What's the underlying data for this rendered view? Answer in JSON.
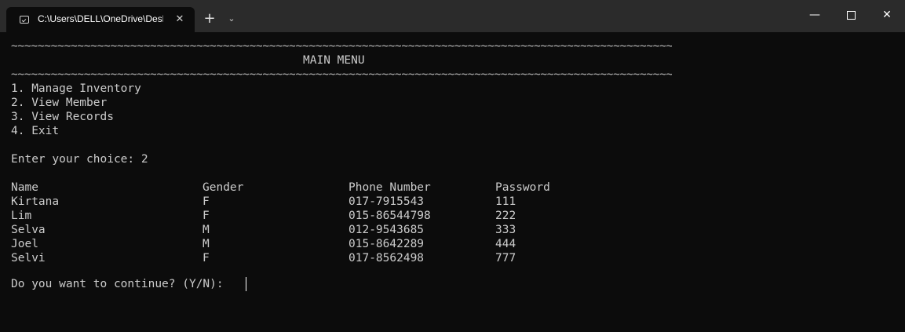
{
  "window": {
    "tab_title": "C:\\Users\\DELL\\OneDrive\\Desk",
    "tab_close": "✕",
    "new_tab": "+",
    "dropdown": "⌄",
    "minimize": "—",
    "close": "✕",
    "icons": {
      "tab": "terminal-icon",
      "maximize": "maximize-icon"
    }
  },
  "console": {
    "rule": "~~~~~~~~~~~~~~~~~~~~~~~~~~~~~~~~~~~~~~~~~~~~~~~~~~~~~~~~~~~~~~~~~~~~~~~~~~~~~~~~~~~~~~~~~~~~~~~~~~~~~~~",
    "menu_title": "MAIN MENU",
    "menu_items": [
      "1. Manage Inventory",
      "2. View Member",
      "3. View Records",
      "4. Exit"
    ],
    "choice_prompt": "Enter your choice: 2",
    "table": {
      "headers": [
        "Name",
        "Gender",
        "Phone Number",
        "Password"
      ],
      "rows": [
        [
          "Kirtana",
          "F",
          "017-7915543",
          "111"
        ],
        [
          "Lim",
          "F",
          "015-86544798",
          "222"
        ],
        [
          "Selva",
          "M",
          "012-9543685",
          "333"
        ],
        [
          "Joel",
          "M",
          "015-8642289",
          "444"
        ],
        [
          "Selvi",
          "F",
          "017-8562498",
          "777"
        ]
      ]
    },
    "continue_prompt": "Do you want to continue? (Y/N): "
  }
}
